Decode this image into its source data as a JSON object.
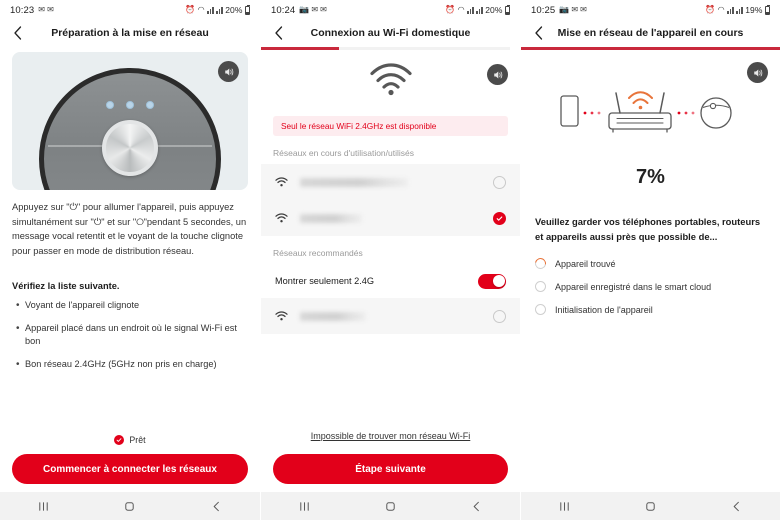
{
  "screens": [
    {
      "statusbar": {
        "time": "10:23",
        "battery": "20%"
      },
      "header": {
        "title": "Préparation à la mise en réseau",
        "back_icon": "chevron-left-icon"
      },
      "progress": {
        "percent": 0,
        "visible": false
      },
      "device_card": {
        "speaker_icon": "speaker-icon",
        "device_icon": "robot-vacuum-image"
      },
      "paragraph": "Appuyez sur \"⏻\" pour allumer l'appareil, puis appuyez simultanément sur \"⏻\" et sur \"⭘\"pendant 5 secondes, un message vocal retentit et le voyant de la touche clignote pour passer en mode de distribution réseau.",
      "checklist_heading": "Vérifiez la liste suivante.",
      "checklist": [
        "Voyant de l'appareil clignote",
        "Appareil placé dans un endroit où le signal Wi-Fi est bon",
        "Bon réseau 2.4GHz (5GHz non pris en charge)"
      ],
      "ready_label": "Prêt",
      "cta_label": "Commencer à connecter les réseaux"
    },
    {
      "statusbar": {
        "time": "10:24",
        "battery": "20%"
      },
      "header": {
        "title": "Connexion au Wi-Fi domestique",
        "back_icon": "chevron-left-icon"
      },
      "progress": {
        "percent": 30,
        "visible": true
      },
      "hero": {
        "wifi_icon": "wifi-icon",
        "speaker_icon": "speaker-icon"
      },
      "alert": "Seul le réseau WiFi 2.4GHz est disponible",
      "section_used_label": "Réseaux en cours d'utilisation/utilisés",
      "used_networks": [
        {
          "ssid": "",
          "redacted": true,
          "selected": false
        },
        {
          "ssid": "",
          "redacted": true,
          "selected": true
        }
      ],
      "section_recommended_label": "Réseaux recommandés",
      "toggle": {
        "label": "Montrer seulement 2.4G",
        "on": true
      },
      "recommended_networks": [
        {
          "ssid": "",
          "redacted": true,
          "selected": false
        }
      ],
      "help_link": "Impossible de trouver mon réseau Wi-Fi",
      "cta_label": "Étape suivante"
    },
    {
      "statusbar": {
        "time": "10:25",
        "battery": "19%"
      },
      "header": {
        "title": "Mise en réseau de l'appareil en cours",
        "back_icon": "chevron-left-icon"
      },
      "progress": {
        "percent": 100,
        "visible": true
      },
      "hero": {
        "speaker_icon": "speaker-icon",
        "diagram_icon": "phone-router-robot-diagram"
      },
      "percent_label": "7%",
      "guidance": "Veuillez garder vos téléphones portables, routeurs et appareils aussi près que possible de...",
      "steps": [
        {
          "label": "Appareil trouvé",
          "state": "active"
        },
        {
          "label": "Appareil enregistré dans le smart cloud",
          "state": "pending"
        },
        {
          "label": "Initialisation de l'appareil",
          "state": "pending"
        }
      ]
    }
  ],
  "navbar": {
    "recents_icon": "recents-icon",
    "home_icon": "home-icon",
    "back_icon": "back-icon"
  },
  "colors": {
    "accent": "#e2001a",
    "progress": "#c9293c",
    "alert_bg": "#fdecef",
    "spinner": "#e8743b"
  }
}
